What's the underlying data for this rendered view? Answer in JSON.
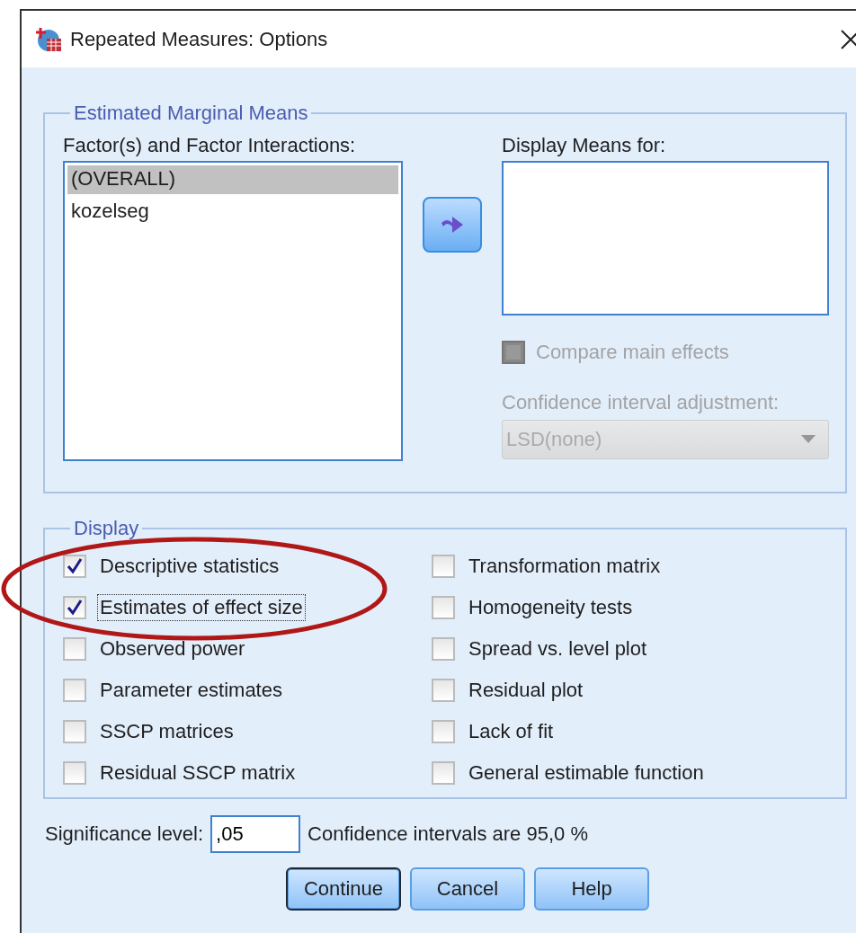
{
  "window": {
    "title": "Repeated Measures: Options"
  },
  "estimated_marginal_means": {
    "title": "Estimated Marginal Means",
    "factors_label": "Factor(s) and Factor Interactions:",
    "factors": [
      {
        "label": "(OVERALL)",
        "selected": true
      },
      {
        "label": "kozelseg",
        "selected": false
      }
    ],
    "display_means_label": "Display Means for:",
    "compare_main_effects": {
      "label": "Compare main effects",
      "checked": false,
      "disabled": true
    },
    "ci_adjustment": {
      "label": "Confidence interval adjustment:",
      "value": "LSD(none)",
      "disabled": true
    }
  },
  "display": {
    "title": "Display",
    "columns": [
      [
        {
          "label": "Descriptive statistics",
          "checked": true,
          "focused": false
        },
        {
          "label": "Estimates of effect size",
          "checked": true,
          "focused": true
        },
        {
          "label": "Observed power",
          "checked": false,
          "focused": false
        },
        {
          "label": "Parameter estimates",
          "checked": false,
          "focused": false
        },
        {
          "label": "SSCP matrices",
          "checked": false,
          "focused": false
        },
        {
          "label": "Residual SSCP matrix",
          "checked": false,
          "focused": false
        }
      ],
      [
        {
          "label": "Transformation matrix",
          "checked": false,
          "focused": false
        },
        {
          "label": "Homogeneity tests",
          "checked": false,
          "focused": false
        },
        {
          "label": "Spread vs. level plot",
          "checked": false,
          "focused": false
        },
        {
          "label": "Residual plot",
          "checked": false,
          "focused": false
        },
        {
          "label": "Lack of fit",
          "checked": false,
          "focused": false
        },
        {
          "label": "General estimable function",
          "checked": false,
          "focused": false
        }
      ]
    ]
  },
  "significance": {
    "label": "Significance level:",
    "value": ",05",
    "note": "Confidence intervals are 95,0 %"
  },
  "buttons": [
    {
      "label": "Continue",
      "default": true
    },
    {
      "label": "Cancel",
      "default": false
    },
    {
      "label": "Help",
      "default": false
    }
  ]
}
